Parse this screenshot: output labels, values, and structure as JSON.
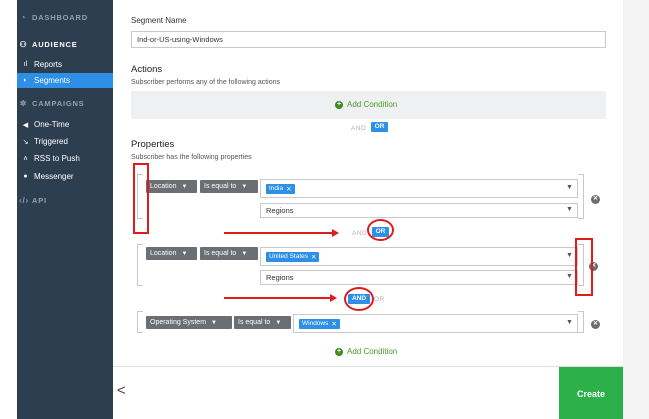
{
  "sidebar": {
    "dashboard": "DASHBOARD",
    "audience": "AUDIENCE",
    "reports": "Reports",
    "segments": "Segments",
    "campaigns": "CAMPAIGNS",
    "one_time": "One-Time",
    "triggered": "Triggered",
    "rss": "RSS to Push",
    "messenger": "Messenger",
    "api": "API"
  },
  "form": {
    "segment_name_label": "Segment Name",
    "segment_name_value": "Ind-or-US-using-Windows",
    "actions_title": "Actions",
    "actions_sub": "Subscriber performs any of the following actions",
    "add_condition": "Add Condition",
    "and": "AND",
    "or": "OR",
    "properties_title": "Properties",
    "properties_sub": "Subscriber has the following properties"
  },
  "conditions": [
    {
      "field": "Location",
      "operator": "Is equal to",
      "value": "India",
      "region_placeholder": "Regions"
    },
    {
      "field": "Location",
      "operator": "Is equal to",
      "value": "United States",
      "region_placeholder": "Regions"
    },
    {
      "field": "Operating System",
      "operator": "Is equal to",
      "value": "Windows"
    }
  ],
  "footer": {
    "create": "Create",
    "back": "<"
  },
  "colors": {
    "sidebar": "#2d3e50",
    "accent": "#2d8fe6",
    "create": "#2bb04a",
    "annotation": "#e01b1b"
  }
}
